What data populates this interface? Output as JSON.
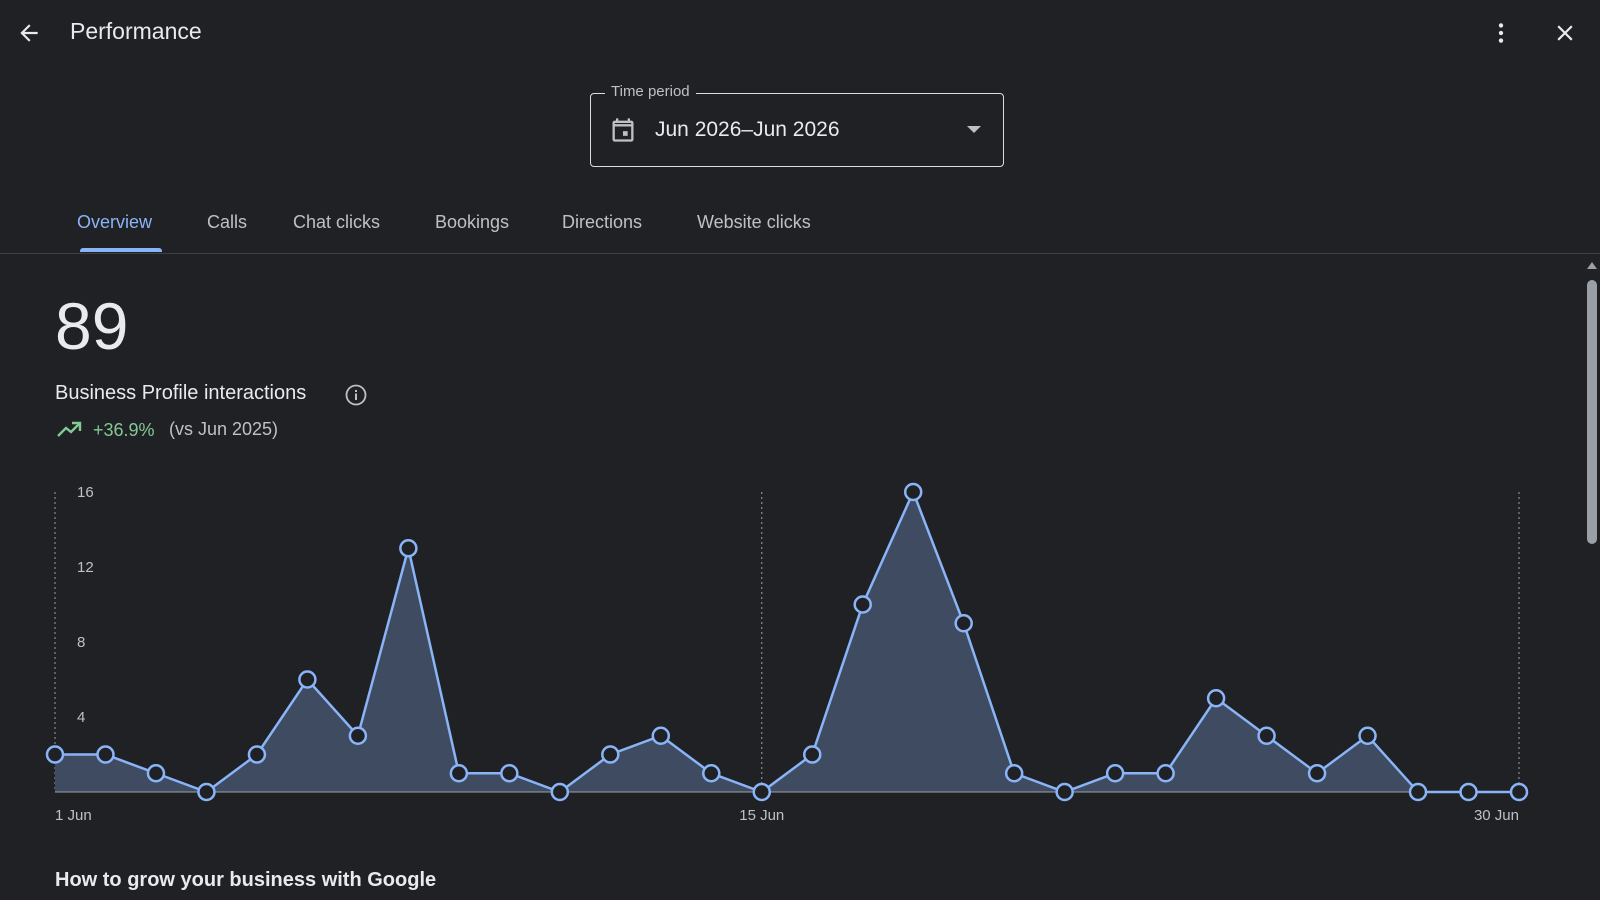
{
  "header": {
    "title": "Performance",
    "back_icon": "arrow-back-icon",
    "more_icon": "more-vert-icon",
    "close_icon": "close-icon"
  },
  "time_period": {
    "label": "Time period",
    "value": "Jun 2026–Jun 2026"
  },
  "tabs": [
    {
      "label": "Overview",
      "active": true
    },
    {
      "label": "Calls",
      "active": false
    },
    {
      "label": "Chat clicks",
      "active": false
    },
    {
      "label": "Bookings",
      "active": false
    },
    {
      "label": "Directions",
      "active": false
    },
    {
      "label": "Website clicks",
      "active": false
    }
  ],
  "summary": {
    "total": "89",
    "metric": "Business Profile interactions",
    "change": "+36.9%",
    "comparison": "(vs Jun 2025)"
  },
  "colors": {
    "accent": "#8ab4f8",
    "positive": "#81c995",
    "background": "#202124"
  },
  "chart_data": {
    "type": "area",
    "x_labels": [
      "1 Jun",
      "15 Jun",
      "30 Jun"
    ],
    "x": [
      1,
      2,
      3,
      4,
      5,
      6,
      7,
      8,
      9,
      10,
      11,
      12,
      13,
      14,
      15,
      16,
      17,
      18,
      19,
      20,
      21,
      22,
      23,
      24,
      25,
      26,
      27,
      28,
      29,
      30
    ],
    "values": [
      2,
      2,
      1,
      0,
      2,
      6,
      3,
      13,
      1,
      1,
      0,
      2,
      3,
      1,
      0,
      2,
      10,
      16,
      9,
      1,
      0,
      1,
      1,
      5,
      3,
      1,
      3,
      0,
      0,
      0
    ],
    "y_ticks": [
      "4",
      "8",
      "12",
      "16"
    ],
    "ylim": [
      0,
      16
    ],
    "vertical_markers": [
      1,
      15,
      30
    ]
  },
  "section": {
    "heading": "How to grow your business with Google"
  }
}
